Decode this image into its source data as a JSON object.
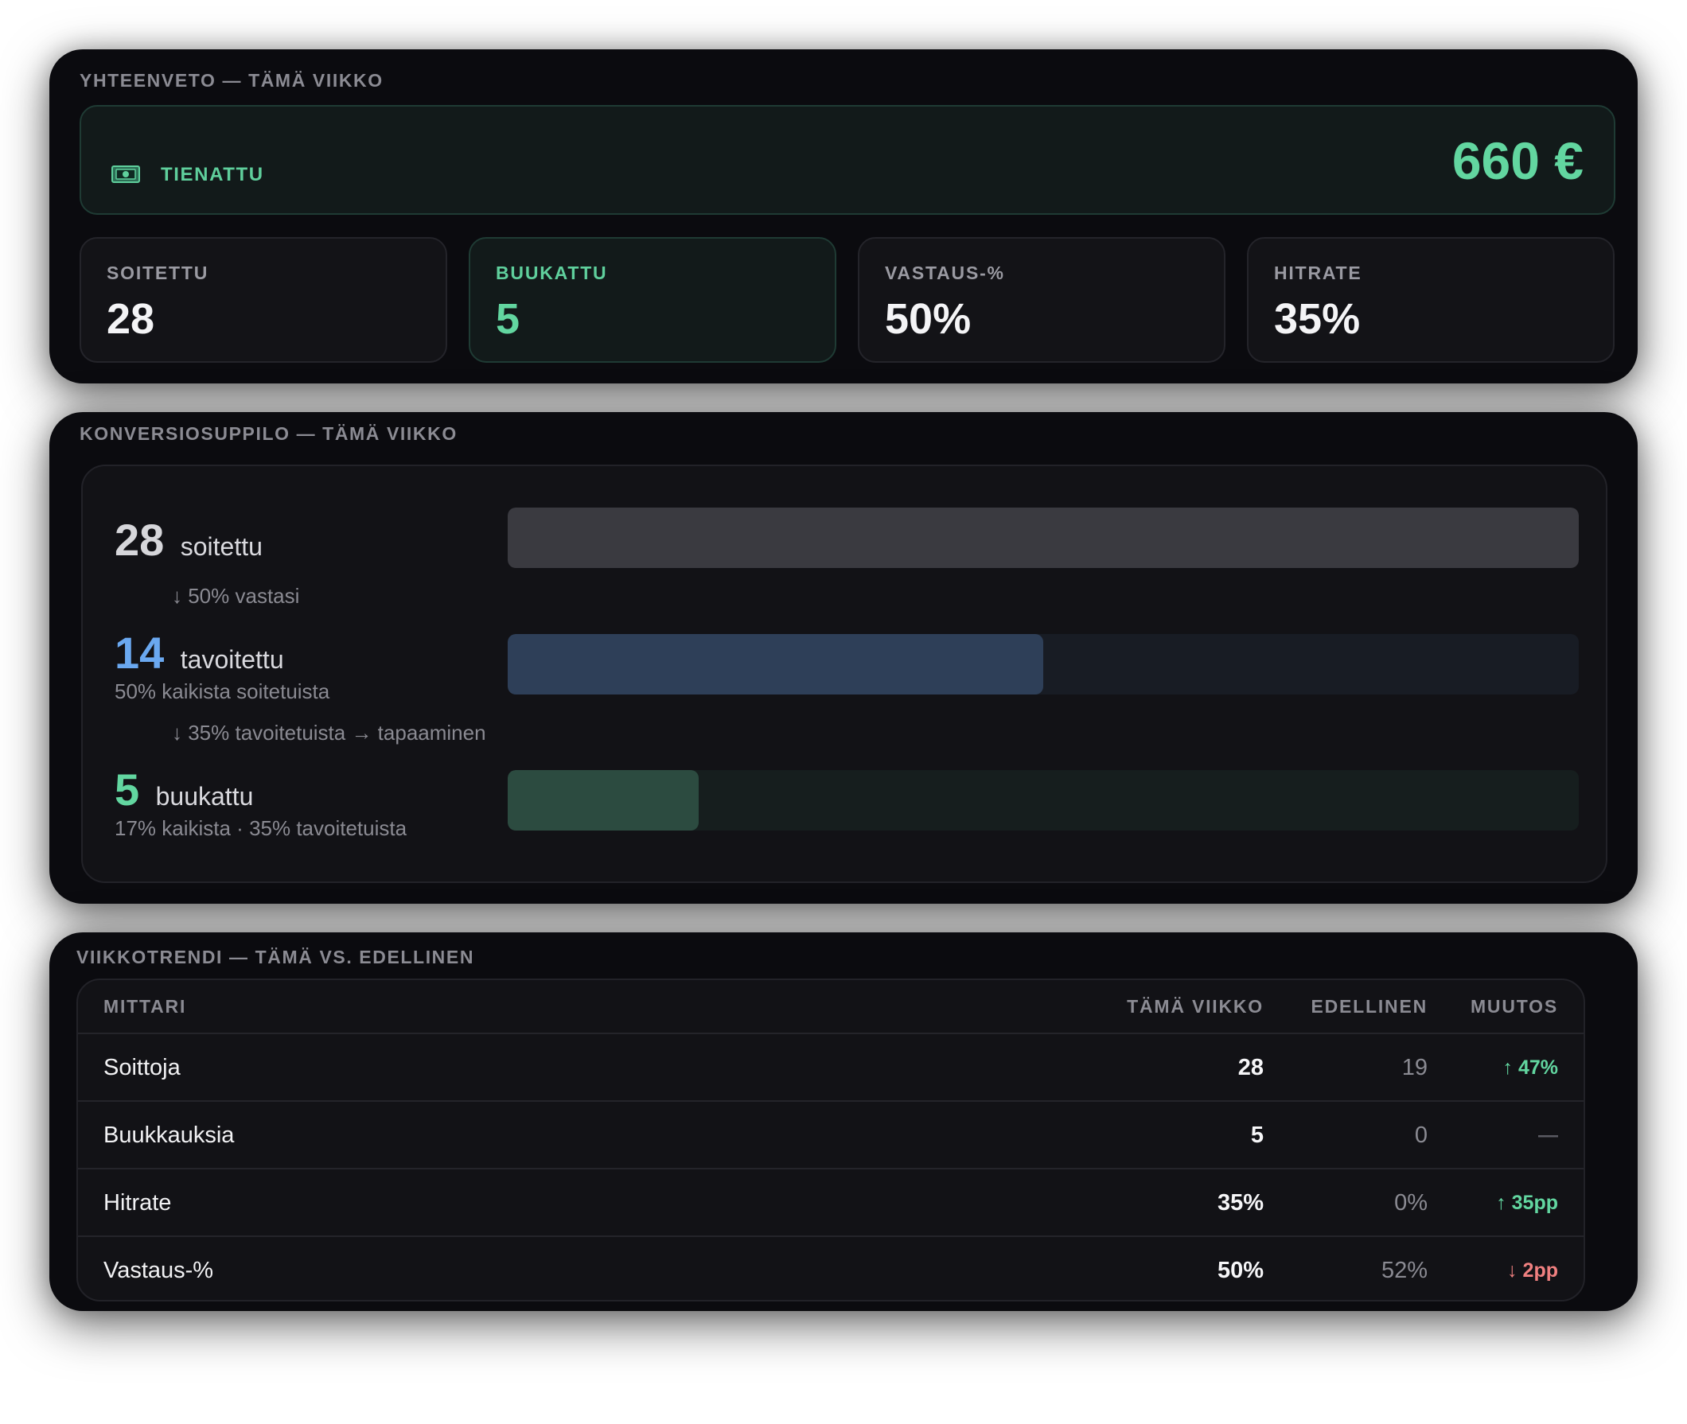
{
  "summary": {
    "title": "YHTEENVETO — TÄMÄ VIIKKO",
    "earned": {
      "icon": "money-icon",
      "label": "TIENATTU",
      "value": "660 €"
    },
    "stats": [
      {
        "label": "SOITETTU",
        "value": "28"
      },
      {
        "label": "BUUKATTU",
        "value": "5"
      },
      {
        "label": "VASTAUS-%",
        "value": "50%"
      },
      {
        "label": "HITRATE",
        "value": "35%"
      }
    ]
  },
  "funnel": {
    "title": "KONVERSIOSUPPILO — TÄMÄ VIIKKO",
    "stages": [
      {
        "number": "28",
        "word": "soitettu",
        "sub": "",
        "fraction": 1.0
      },
      {
        "number": "14",
        "word": "tavoitettu",
        "sub": "50% kaikista soitetuista",
        "fraction": 0.5
      },
      {
        "number": "5",
        "word": "buukattu",
        "sub": "17% kaikista · 35% tavoitetuista",
        "fraction": 0.1786
      }
    ],
    "steps": [
      "↓ 50% vastasi",
      "↓ 35% tavoitetuista → tapaaminen"
    ]
  },
  "trend": {
    "title": "VIIKKOTRENDI — TÄMÄ VS. EDELLINEN",
    "headers": {
      "metric": "MITTARI",
      "this_week": "TÄMÄ VIIKKO",
      "previous": "EDELLINEN",
      "change": "MUUTOS"
    },
    "rows": [
      {
        "metric": "Soittoja",
        "this_week": "28",
        "previous": "19",
        "change": "↑ 47%",
        "direction": "up"
      },
      {
        "metric": "Buukkauksia",
        "this_week": "5",
        "previous": "0",
        "change": "—",
        "direction": "none"
      },
      {
        "metric": "Hitrate",
        "this_week": "35%",
        "previous": "0%",
        "change": "↑ 35pp",
        "direction": "up"
      },
      {
        "metric": "Vastaus-%",
        "this_week": "50%",
        "previous": "52%",
        "change": "↓ 2pp",
        "direction": "down"
      }
    ]
  },
  "colors": {
    "accent_green": "#62d6a0",
    "accent_blue": "#6aa8f0",
    "down_red": "#f08080",
    "bar_gray": "#3a3a40",
    "bar_blue": "#2e3f58",
    "bar_green": "#2c4b40",
    "track_blue": "#181c24",
    "track_green": "#161e1e"
  }
}
